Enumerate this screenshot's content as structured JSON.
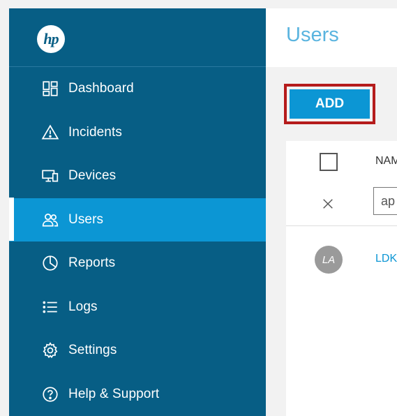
{
  "brand": {
    "logo_text": "hp"
  },
  "sidebar": {
    "items": [
      {
        "label": "Dashboard",
        "icon": "dashboard-icon",
        "active": false
      },
      {
        "label": "Incidents",
        "icon": "warning-icon",
        "active": false
      },
      {
        "label": "Devices",
        "icon": "devices-icon",
        "active": false
      },
      {
        "label": "Users",
        "icon": "users-icon",
        "active": true
      },
      {
        "label": "Reports",
        "icon": "reports-icon",
        "active": false
      },
      {
        "label": "Logs",
        "icon": "logs-icon",
        "active": false
      },
      {
        "label": "Settings",
        "icon": "gear-icon",
        "active": false
      },
      {
        "label": "Help & Support",
        "icon": "help-icon",
        "active": false
      }
    ]
  },
  "main": {
    "title": "Users",
    "add_label": "ADD",
    "table": {
      "name_header": "NAM",
      "filter_value": "ap",
      "rows": [
        {
          "avatar_initials": "LA",
          "name": "LDK"
        }
      ]
    }
  },
  "colors": {
    "sidebar": "#075e85",
    "active_item": "#0c96d4",
    "title": "#5ab4df",
    "highlight_border": "#b51c1c",
    "avatar": "#9a9a9a"
  }
}
